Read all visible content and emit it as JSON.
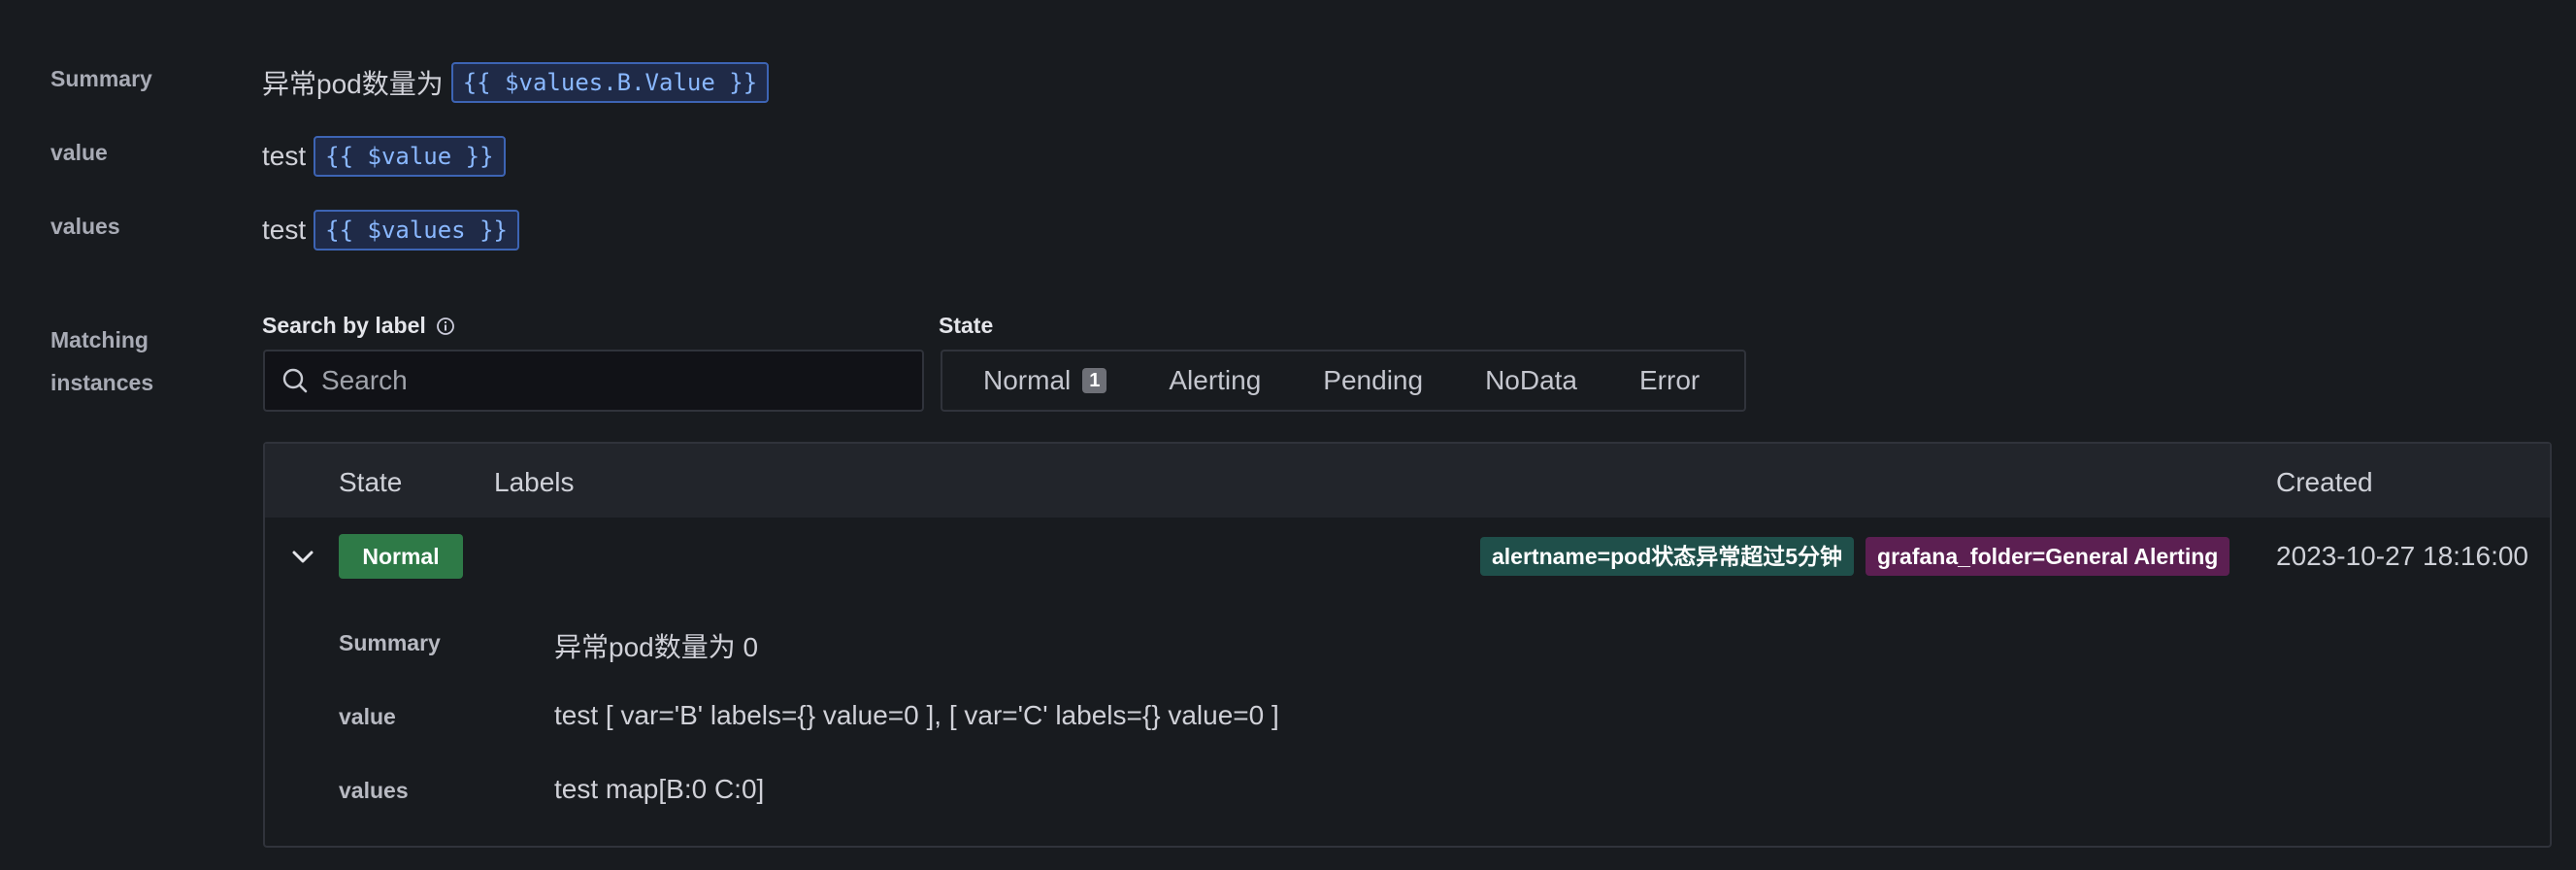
{
  "annotations": [
    {
      "label": "Summary",
      "text": "异常pod数量为",
      "template": "{{ $values.B.Value }}"
    },
    {
      "label": "value",
      "text": "test",
      "template": "{{ $value }}"
    },
    {
      "label": "values",
      "text": "test",
      "template": "{{ $values }}"
    }
  ],
  "matching": {
    "label_line1": "Matching",
    "label_line2": "instances",
    "search_label": "Search by label",
    "search_placeholder": "Search",
    "state_label": "State",
    "states": [
      {
        "label": "Normal",
        "count": "1"
      },
      {
        "label": "Alerting"
      },
      {
        "label": "Pending"
      },
      {
        "label": "NoData"
      },
      {
        "label": "Error"
      }
    ]
  },
  "table": {
    "headers": {
      "state": "State",
      "labels": "Labels",
      "created": "Created"
    },
    "row": {
      "state": "Normal",
      "tags": [
        {
          "text": "alertname=pod状态异常超过5分钟",
          "color": "#1f4f4a"
        },
        {
          "text": "grafana_folder=General Alerting",
          "color": "#5c1f52"
        }
      ],
      "created": "2023-10-27 18:16:00",
      "details": [
        {
          "label": "Summary",
          "value": "异常pod数量为 0"
        },
        {
          "label": "value",
          "value": "test [ var='B' labels={} value=0 ], [ var='C' labels={} value=0 ]"
        },
        {
          "label": "values",
          "value": "test map[B:0 C:0]"
        }
      ]
    }
  },
  "colors": {
    "background": "#181b1f",
    "normal_green": "#2e7a47",
    "template_blue": "#8ab8ff"
  }
}
